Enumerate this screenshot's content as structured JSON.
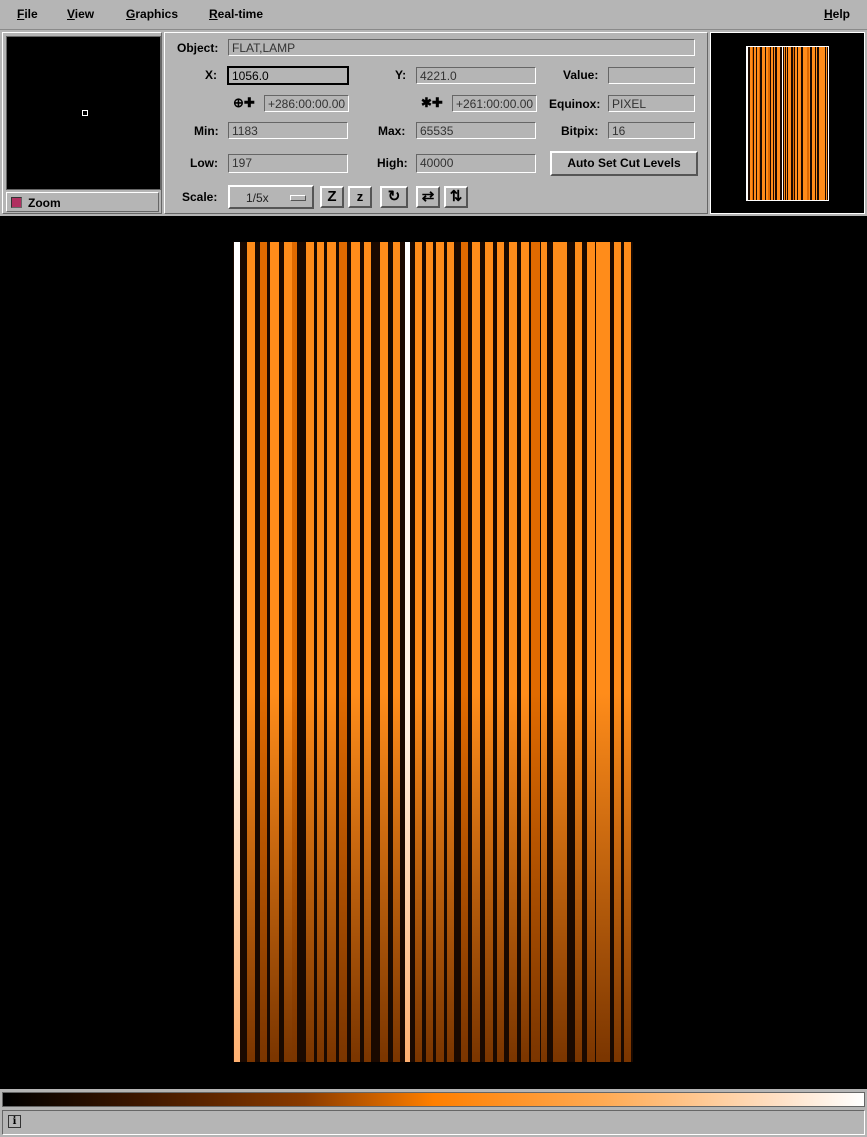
{
  "menubar": {
    "items": [
      {
        "mnemonic": "F",
        "rest": "ile"
      },
      {
        "mnemonic": "V",
        "rest": "iew"
      },
      {
        "mnemonic": "G",
        "rest": "raphics"
      },
      {
        "mnemonic": "R",
        "rest": "eal-time"
      }
    ],
    "help": {
      "mnemonic": "H",
      "rest": "elp"
    }
  },
  "zoom": {
    "label": "Zoom",
    "checked": true
  },
  "info": {
    "object_label": "Object:",
    "object_value": "FLAT,LAMP",
    "x_label": "X:",
    "x_value": "1056.0",
    "y_label": "Y:",
    "y_value": "4221.0",
    "value_label": "Value:",
    "value_value": "",
    "ra_icon": "⊕✚",
    "ra_value": "+286:00:00.00",
    "dec_icon": "✱✚",
    "dec_value": "+261:00:00.00",
    "equinox_label": "Equinox:",
    "equinox_value": "PIXEL",
    "min_label": "Min:",
    "min_value": "1183",
    "max_label": "Max:",
    "max_value": "65535",
    "bitpix_label": "Bitpix:",
    "bitpix_value": "16",
    "low_label": "Low:",
    "low_value": "197",
    "high_label": "High:",
    "high_value": "40000",
    "auto_cut_label": "Auto Set Cut Levels",
    "scale_label": "Scale:",
    "scale_value": "1/5x"
  },
  "toolbar": {
    "zoom_in_glyph": "Z",
    "zoom_out_glyph": "z",
    "rotate_glyph": "↻",
    "flip_x_glyph": "⇄",
    "flip_y_glyph": "⇅"
  },
  "image": {
    "colormap": [
      "#000000",
      "#3a1500",
      "#8a3a00",
      "#ff7f00",
      "#ffab55",
      "#ffe0c5",
      "#ffffff"
    ],
    "fiber_colors": {
      "bright": "#ff8c1a",
      "dim": "#e06a00",
      "hot": "#ffffff",
      "faint": "#3a1800"
    }
  },
  "status": {
    "info_icon": "i"
  }
}
